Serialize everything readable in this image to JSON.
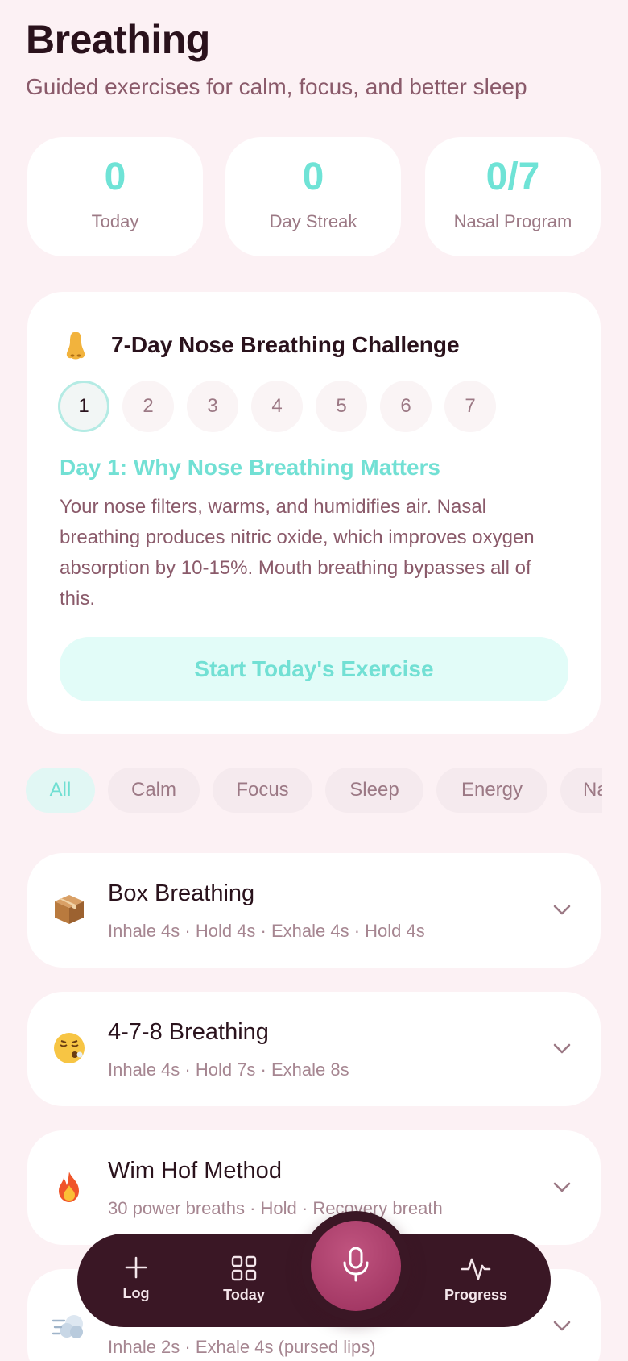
{
  "header": {
    "title": "Breathing",
    "subtitle": "Guided exercises for calm, focus, and better sleep"
  },
  "stats": [
    {
      "value": "0",
      "label": "Today"
    },
    {
      "value": "0",
      "label": "Day Streak"
    },
    {
      "value": "0/7",
      "label": "Nasal Program"
    }
  ],
  "challenge": {
    "icon": "nose-emoji-icon",
    "title": "7-Day Nose Breathing Challenge",
    "days": [
      "1",
      "2",
      "3",
      "4",
      "5",
      "6",
      "7"
    ],
    "active_day": "1",
    "day_title": "Day 1: Why Nose Breathing Matters",
    "day_body": "Your nose filters, warms, and humidifies air. Nasal breathing produces nitric oxide, which improves oxygen absorption by 10-15%. Mouth breathing bypasses all of this.",
    "button_label": "Start Today's Exercise"
  },
  "filters": [
    {
      "label": "All",
      "active": true
    },
    {
      "label": "Calm",
      "active": false
    },
    {
      "label": "Focus",
      "active": false
    },
    {
      "label": "Sleep",
      "active": false
    },
    {
      "label": "Energy",
      "active": false
    },
    {
      "label": "Nasal",
      "active": false
    }
  ],
  "exercises": [
    {
      "icon": "package-emoji-icon",
      "name": "Box Breathing",
      "desc": "Inhale 4s · Hold 4s · Exhale 4s · Hold 4s"
    },
    {
      "icon": "relieved-face-emoji-icon",
      "name": "4-7-8 Breathing",
      "desc": "Inhale 4s · Hold 7s · Exhale 8s"
    },
    {
      "icon": "fire-emoji-icon",
      "name": "Wim Hof Method",
      "desc": "30 power breaths · Hold · Recovery breath"
    },
    {
      "icon": "dash-emoji-icon",
      "name": "",
      "desc": "Inhale 2s · Exhale 4s (pursed lips)"
    }
  ],
  "nav": {
    "log": "Log",
    "today": "Today",
    "progress": "Progress"
  },
  "colors": {
    "background": "#fcf1f4",
    "accent_teal": "#6fe3d6",
    "nav_dark": "#3a1725",
    "mic_pink": "#b0426f"
  }
}
